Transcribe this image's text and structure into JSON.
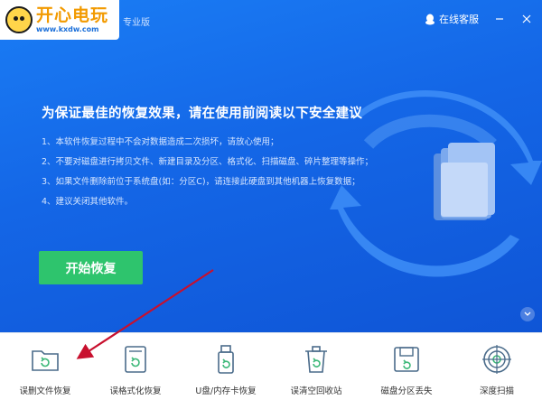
{
  "watermark": {
    "name": "开心电玩",
    "url": "www.kxdw.com"
  },
  "titlebar": {
    "edition": "专业版",
    "service_label": "在线客服"
  },
  "main": {
    "headline": "为保证最佳的恢复效果，请在使用前阅读以下安全建议",
    "tips": [
      "1、本软件恢复过程中不会对数据造成二次损坏，请放心使用；",
      "2、不要对磁盘进行拷贝文件、新建目录及分区、格式化、扫描磁盘、碎片整理等操作；",
      "3、如果文件删除前位于系统盘(如：分区C)，请连接此硬盘到其他机器上恢复数据；",
      "4、建议关闭其他软件。"
    ],
    "start_button": "开始恢复"
  },
  "modes": [
    {
      "label": "误删文件恢复",
      "icon": "deleted-file-icon"
    },
    {
      "label": "误格式化恢复",
      "icon": "formatted-disk-icon"
    },
    {
      "label": "U盘/内存卡恢复",
      "icon": "usb-drive-icon"
    },
    {
      "label": "误清空回收站",
      "icon": "recycle-bin-icon"
    },
    {
      "label": "磁盘分区丢失",
      "icon": "lost-partition-icon"
    },
    {
      "label": "深度扫描",
      "icon": "deep-scan-icon"
    }
  ],
  "colors": {
    "primary_blue": "#1466e6",
    "start_green": "#2ec46d",
    "icon_stroke": "#4a6b8a",
    "icon_accent": "#3cb878",
    "annotation_arrow": "#c8102e"
  }
}
